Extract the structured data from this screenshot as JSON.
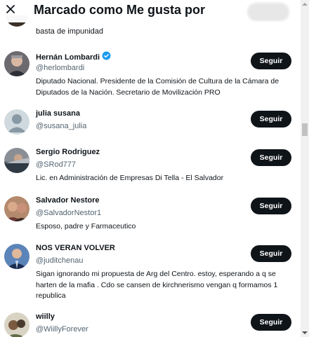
{
  "header": {
    "title": "Marcado como Me gusta por",
    "close_icon": "close-icon"
  },
  "previous_bio": "basta de impunidad",
  "follow_label": "Seguir",
  "users": [
    {
      "name": "Hernán Lombardi",
      "verified": true,
      "handle": "@herlombardi",
      "bio": "Diputado Nacional. Presidente de la Comisión de Cultura de la Cámara de Diputados de la Nación. Secretario de Movilización PRO",
      "follow": "Seguir"
    },
    {
      "name": "julia susana",
      "verified": false,
      "handle": "@susana_julia",
      "bio": "",
      "follow": "Seguir"
    },
    {
      "name": "Sergio Rodriguez",
      "verified": false,
      "handle": "@SRod777",
      "bio": "Lic. en Administración de Empresas Di Tella - El Salvador",
      "follow": "Seguir"
    },
    {
      "name": "Salvador Nestore",
      "verified": false,
      "handle": "@SalvadorNestor1",
      "bio": "Esposo, padre y Farmaceutico",
      "follow": "Seguir"
    },
    {
      "name": "NOS VERAN VOLVER",
      "verified": false,
      "handle": "@juditchenau",
      "bio": "Sigan ignorando mi propuesta de Arg del Centro. estoy, esperando a q se harten de la mafia . Cdo se cansen de kirchnerismo vengan q formamos 1 republica",
      "follow": "Seguir"
    },
    {
      "name": "wiilly",
      "verified": false,
      "handle": "@WiillyForever",
      "bio": "",
      "follow": "Seguir"
    }
  ],
  "colors": {
    "text": "#0f1419",
    "secondary": "#536471",
    "verified": "#1d9bf0",
    "button": "#0f1419"
  }
}
